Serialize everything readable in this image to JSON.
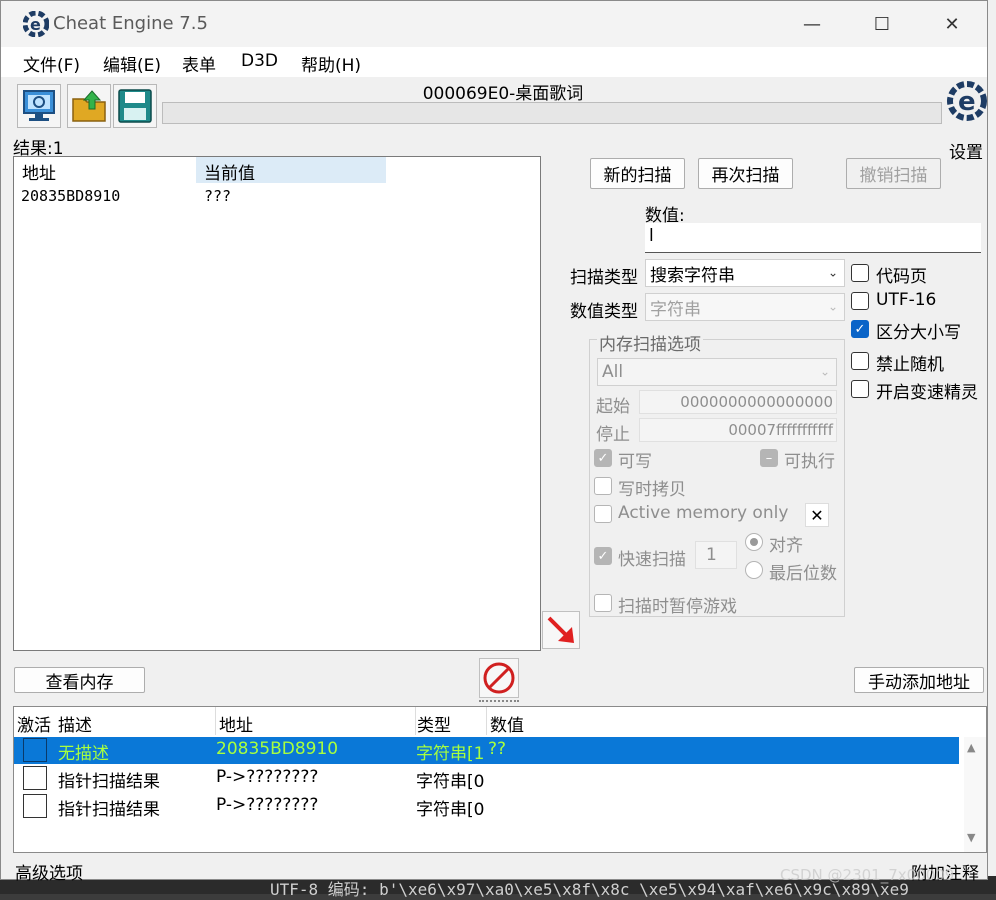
{
  "window": {
    "title": "Cheat Engine 7.5",
    "min": "—",
    "max": "☐",
    "close": "✕"
  },
  "menu": [
    "文件(F)",
    "编辑(E)",
    "表单",
    "D3D",
    "帮助(H)"
  ],
  "process_title": "000069E0-桌面歌词",
  "settings_label": "设置",
  "results": {
    "label": "结果:1",
    "headers": [
      "地址",
      "当前值"
    ],
    "rows": [
      {
        "address": "20835BD8910",
        "value": "???"
      }
    ]
  },
  "scan_buttons": {
    "new": "新的扫描",
    "next": "再次扫描",
    "undo": "撤销扫描"
  },
  "value": {
    "label": "数值:",
    "input": "l"
  },
  "scan_type": {
    "label": "扫描类型",
    "selected": "搜索字符串"
  },
  "value_type": {
    "label": "数值类型",
    "selected": "字符串"
  },
  "right_checks": [
    {
      "label": "代码页",
      "checked": false
    },
    {
      "label": "UTF-16",
      "checked": false
    },
    {
      "label": "区分大小写",
      "checked": true
    },
    {
      "label": "禁止随机",
      "checked": false
    },
    {
      "label": "开启变速精灵",
      "checked": false
    }
  ],
  "mem_options": {
    "title": "内存扫描选项",
    "region": "All",
    "start_label": "起始",
    "start_value": "0000000000000000",
    "stop_label": "停止",
    "stop_value": "00007fffffffffff",
    "writable": "可写",
    "executable": "可执行",
    "copy_on_write": "写时拷贝",
    "active_memory": "Active memory only",
    "fast_scan": "快速扫描",
    "fast_scan_value": "1",
    "align": "对齐",
    "last_digits": "最后位数",
    "pause": "扫描时暂停游戏"
  },
  "view_memory": "查看内存",
  "add_address": "手动添加地址",
  "address_table": {
    "headers": [
      "激活",
      "描述",
      "地址",
      "类型",
      "数值"
    ],
    "rows": [
      {
        "desc": "无描述",
        "address": "20835BD8910",
        "type": "字符串[1",
        "value": "??"
      },
      {
        "desc": "指针扫描结果",
        "address": "P->????????",
        "type": "字符串[0",
        "value": ""
      },
      {
        "desc": "指针扫描结果",
        "address": "P->????????",
        "type": "字符串[0",
        "value": ""
      }
    ]
  },
  "status": {
    "left": "高级选项",
    "right": "附加注释"
  },
  "background": {
    "bottom_text": "UTF-8 编码: b'\\xe6\\x97\\xa0\\xe5\\x8f\\x8c \\xe5\\x94\\xaf\\xe6\\x9c\\x89\\xe9",
    "watermark": "CSDN @2301_7x00009"
  },
  "colors": {
    "selection": "#0a78d7",
    "selection_text": "#a8ff3e",
    "accent": "#0a64c8"
  }
}
